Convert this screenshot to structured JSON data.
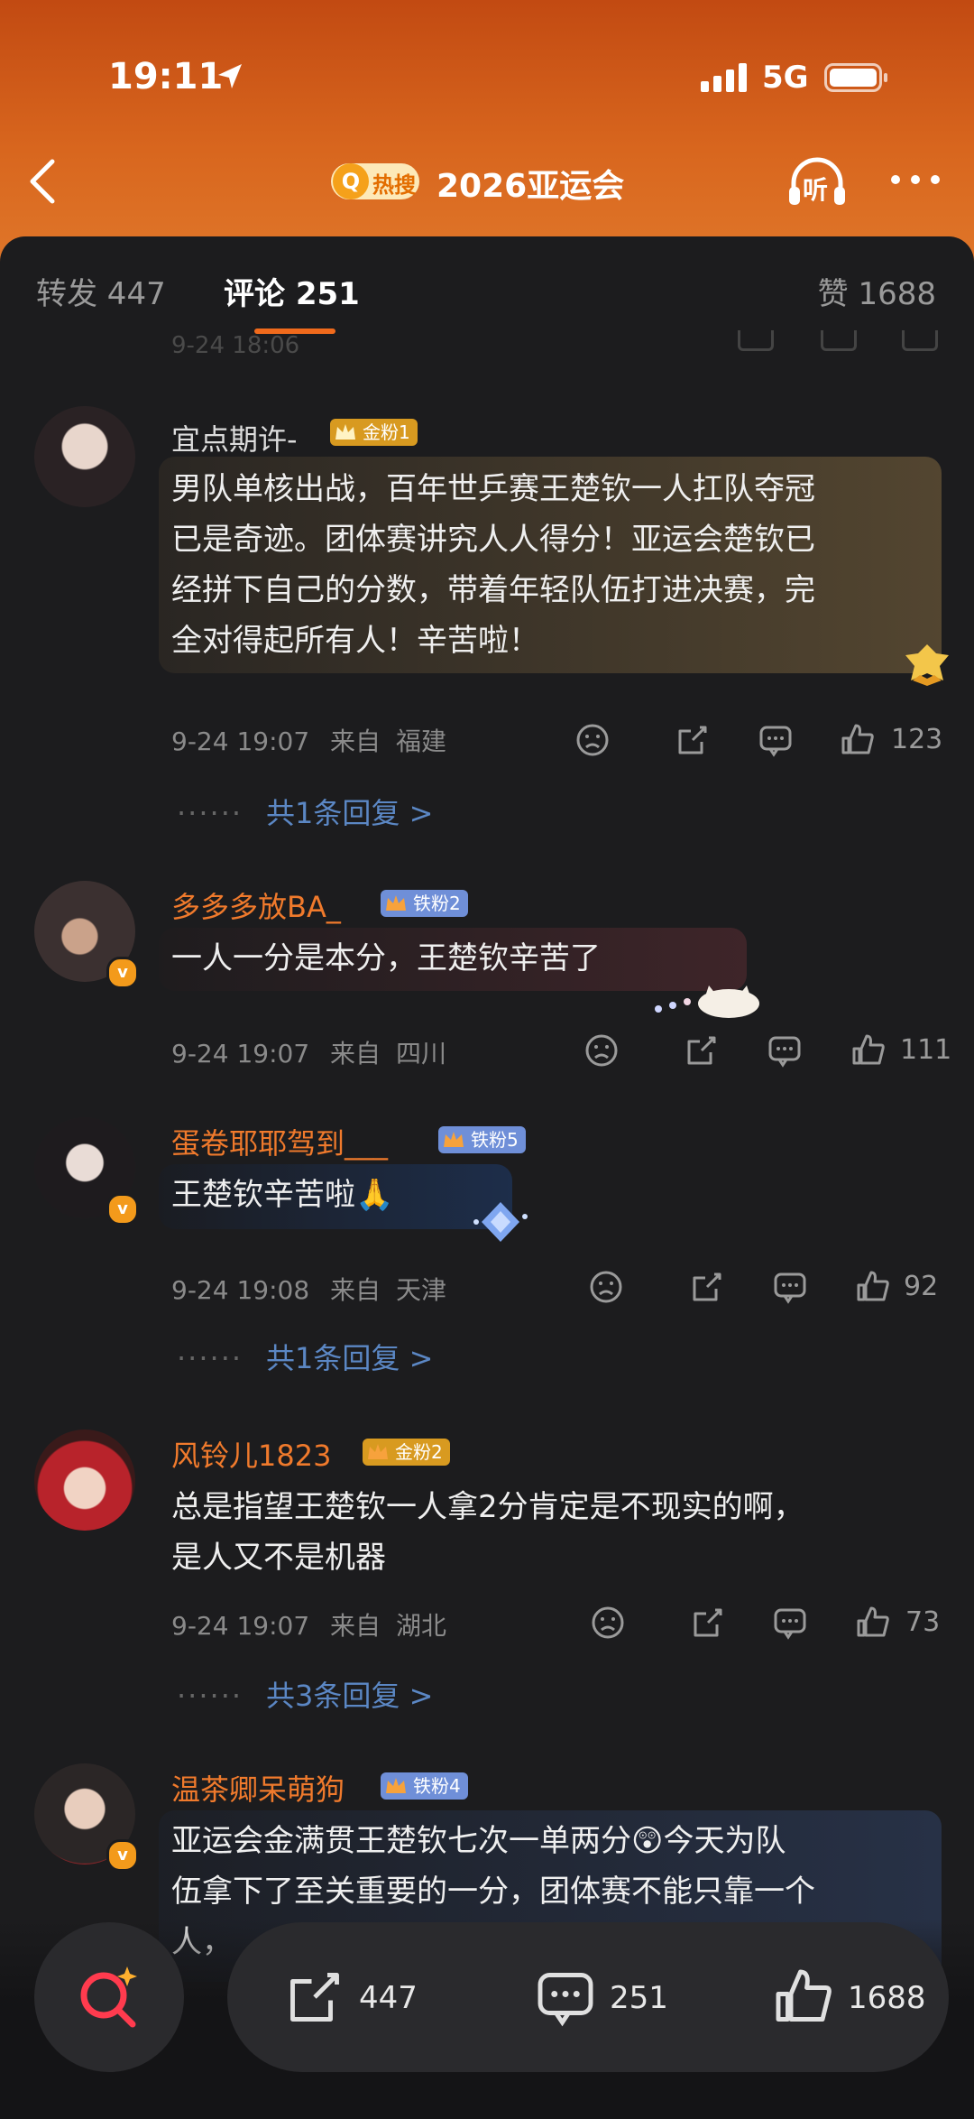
{
  "status_bar": {
    "time": "19:11",
    "network": "5G",
    "icons": [
      "location-arrow-icon",
      "signal-bars-icon",
      "battery-icon"
    ]
  },
  "nav": {
    "back_icon": "chevron-left-icon",
    "hot_search_label": "热搜",
    "title": "2026亚运会",
    "listen_label": "听",
    "more_icon": "more-dots-icon"
  },
  "tabs": {
    "forward": "转发 447",
    "comments": "评论 251",
    "likes": "赞 1688",
    "active": "comments",
    "accent": "#f06a1c"
  },
  "scrolled_meta": "9-24 18:06",
  "comments": [
    {
      "user": "宜点期许-",
      "user_color": "#dcdcdc",
      "fan_badge": "金粉1",
      "text": "男队单核出战，百年世乒赛王楚钦一人扛队夺冠\n已是奇迹。团体赛讲究人人得分！亚运会楚钦已\n经拼下自己的分数，带着年轻队伍打进决赛，完\n全对得起所有人！辛苦啦！",
      "date": "9-24 19:07",
      "location_prefix": "来自",
      "location": "福建",
      "likes": "123",
      "replies": "共1条回复 >"
    },
    {
      "user": "多多多放BA_",
      "user_color": "#f07a2c",
      "fan_badge": "铁粉2",
      "text": "一人一分是本分，王楚钦辛苦了",
      "date": "9-24 19:07",
      "location_prefix": "来自",
      "location": "四川",
      "likes": "111",
      "replies": ""
    },
    {
      "user": "蛋卷耶耶驾到___",
      "user_color": "#f07a2c",
      "fan_badge": "铁粉5",
      "text": "王楚钦辛苦啦🙏",
      "date": "9-24 19:08",
      "location_prefix": "来自",
      "location": "天津",
      "likes": "92",
      "replies": "共1条回复 >"
    },
    {
      "user": "风铃儿1823",
      "user_color": "#f07a2c",
      "fan_badge": "金粉2",
      "text": "总是指望王楚钦一人拿2分肯定是不现实的啊，\n是人又不是机器",
      "date": "9-24 19:07",
      "location_prefix": "来自",
      "location": "湖北",
      "likes": "73",
      "replies": "共3条回复 >"
    },
    {
      "user": "温茶卿呆萌狗",
      "user_color": "#f07a2c",
      "fan_badge": "铁粉4",
      "text": "亚运会金满贯王楚钦七次一单两分😲今天为队\n伍拿下了至关重要的一分，团体赛不能只靠一个\n人，",
      "date": "",
      "location_prefix": "",
      "location": "",
      "likes": "",
      "replies": ""
    }
  ],
  "bottom_bar": {
    "forwards": "447",
    "comments": "251",
    "likes": "1688",
    "search_icon": "ai-search-icon"
  }
}
